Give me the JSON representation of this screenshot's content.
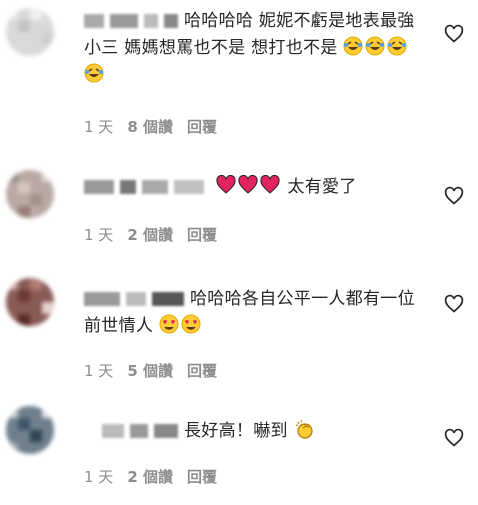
{
  "comments": [
    {
      "text": "哈哈哈哈 妮妮不虧是地表最強小三 媽媽想罵也不是 想打也不是",
      "emojis": [
        "laugh-cry",
        "laugh-cry",
        "laugh-cry",
        "laugh-cry"
      ],
      "time": "1 天",
      "likes": "8 個讚",
      "reply": "回覆"
    },
    {
      "text": "太有愛了",
      "emojis_before": [
        "red-heart",
        "red-heart",
        "red-heart"
      ],
      "time": "1 天",
      "likes": "2 個讚",
      "reply": "回覆"
    },
    {
      "text": "哈哈哈各自公平一人都有一位前世情人",
      "emojis": [
        "heart-eyes",
        "heart-eyes"
      ],
      "time": "1 天",
      "likes": "5 個讚",
      "reply": "回覆"
    },
    {
      "text": "長好高！嚇到",
      "emojis": [
        "clapping-hands"
      ],
      "time": "1 天",
      "likes": "2 個讚",
      "reply": "回覆"
    }
  ],
  "colors": {
    "meta": "#8e8e8e",
    "text": "#262626",
    "heart_emoji": "#e0245e"
  }
}
